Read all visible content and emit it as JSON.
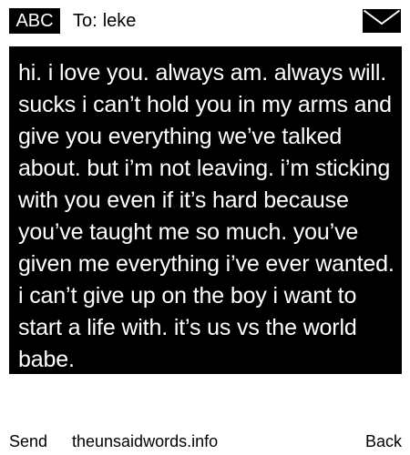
{
  "header": {
    "badge_label": "ABC",
    "to_prefix": "To:",
    "recipient": "leke",
    "envelope_icon": "envelope-icon"
  },
  "message": {
    "text": "hi. i love you. always am. always will. sucks i can’t hold you in my arms and give you everything we’ve talked about. but i’m not leaving. i’m sticking with you even if it’s hard because you’ve taught me so much. you’ve given me everything i’ve ever wanted. i can’t give up on the boy i want to start a life with. it’s us vs the world babe."
  },
  "footer": {
    "send_label": "Send",
    "site_label": "theunsaidwords.info",
    "back_label": "Back"
  },
  "colors": {
    "background": "#ffffff",
    "foreground": "#000000",
    "inverse_text": "#ffffff"
  }
}
